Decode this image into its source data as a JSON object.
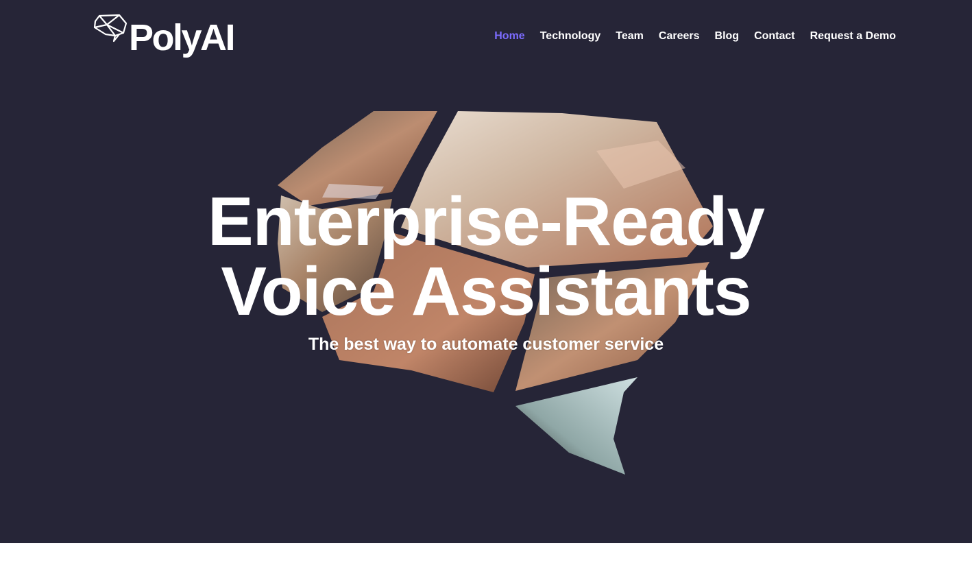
{
  "brand": {
    "name": "PolyAI",
    "logo_icon": "gem-outline-icon"
  },
  "nav": {
    "items": [
      {
        "label": "Home",
        "active": true
      },
      {
        "label": "Technology",
        "active": false
      },
      {
        "label": "Team",
        "active": false
      },
      {
        "label": "Careers",
        "active": false
      },
      {
        "label": "Blog",
        "active": false
      },
      {
        "label": "Contact",
        "active": false
      },
      {
        "label": "Request a Demo",
        "active": false
      }
    ]
  },
  "hero": {
    "headline_line1": "Enterprise-Ready",
    "headline_line2": "Voice Assistants",
    "subheadline": "The best way to automate customer service",
    "image": "fragmented-gem-photo-hand-holding-phone"
  },
  "colors": {
    "background": "#262537",
    "accent": "#7c6cff",
    "text": "#ffffff"
  }
}
